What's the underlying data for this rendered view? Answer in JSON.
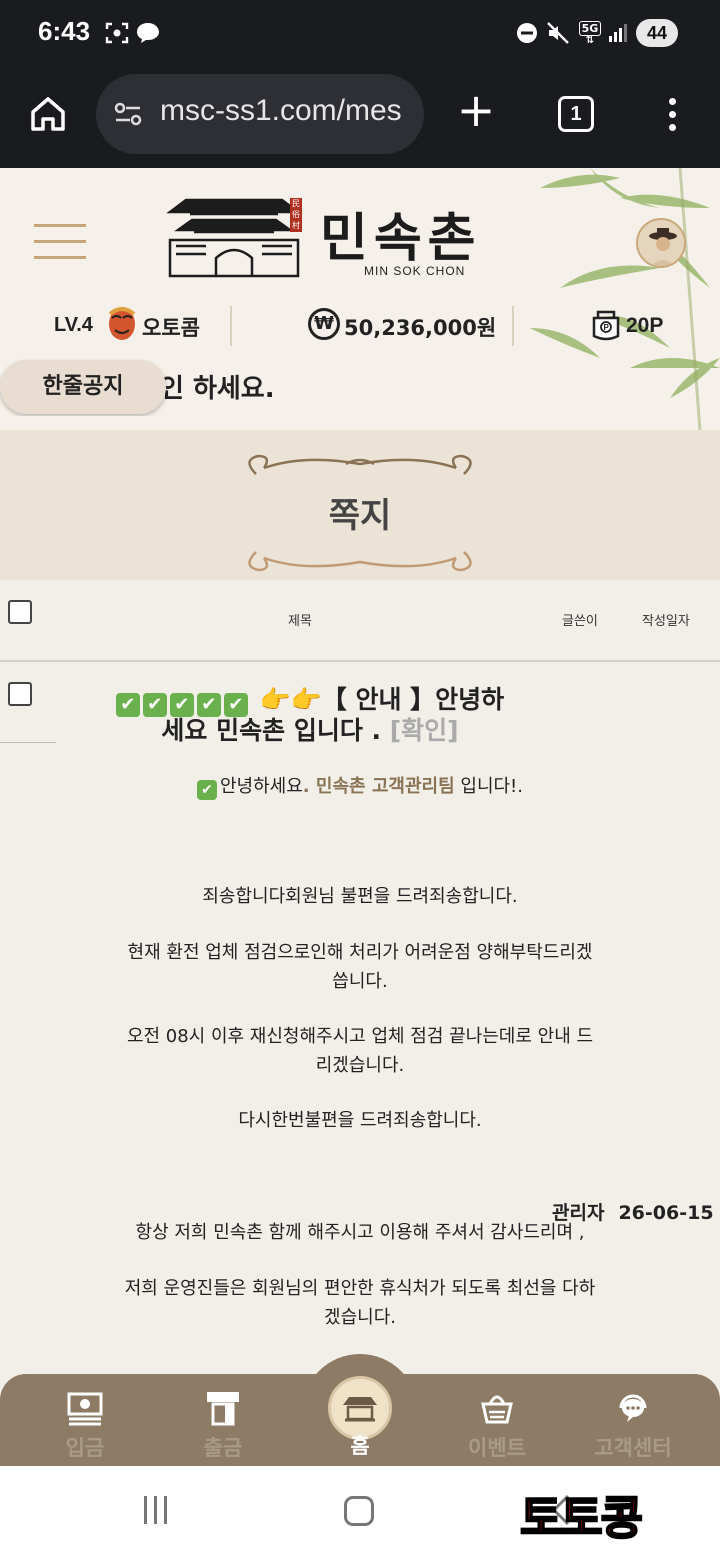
{
  "status_bar": {
    "time": "6:43",
    "network": "5G",
    "battery": "44"
  },
  "browser": {
    "url": "msc-ss1.com/mes",
    "tab_count": "1"
  },
  "site": {
    "logo_title": "민속촌",
    "logo_subtitle": "MIN SOK CHON",
    "logo_stamp": "民俗村"
  },
  "user": {
    "level": "LV.4",
    "name": "오토콤",
    "money": "50,236,000원",
    "points": "20P"
  },
  "notice": {
    "button_label": "한줄공지",
    "text": "인 하세요."
  },
  "page_title": "쪽지",
  "table": {
    "col_subject": "제목",
    "col_author": "글쓴이",
    "col_date": "작성일자"
  },
  "message": {
    "subject_line1_prefix": "👉👉【 안내 】안녕하",
    "subject_line2": "세요 민속촌 입니다 .",
    "confirm_label": "[확인]",
    "greeting_prefix": "안녕하세요",
    "greeting_highlight": ". 민속촌 고객관리팀",
    "greeting_suffix": " 입니다!.",
    "p1": "죄송합니다회원님 불편을 드려죄송합니다.",
    "p2_line1": "현재 환전 업체 점검으로인해 처리가 어려운점 양해부탁드리겠",
    "p2_line2": "씁니다.",
    "p3_line1": "오전 08시 이후 재신청해주시고 업체 점검 끝나는데로 안내 드",
    "p3_line2": "리겠습니다.",
    "p4": "다시한번불편을 드려죄송합니다.",
    "p5": "항상 저희 민속촌 함께 해주시고 이용해 주셔서 감사드리며 ,",
    "p6_line1": "저희 운영진들은 회원님의 편안한 휴식처가 되도록 최선을 다하",
    "p6_line2": "겠습니다.",
    "author": "관리자",
    "date": "26-06-15"
  },
  "bottom_nav": {
    "deposit": "입금",
    "withdraw": "출금",
    "home": "홈",
    "event": "이벤트",
    "support": "고객센터"
  },
  "watermark": "토토콩"
}
